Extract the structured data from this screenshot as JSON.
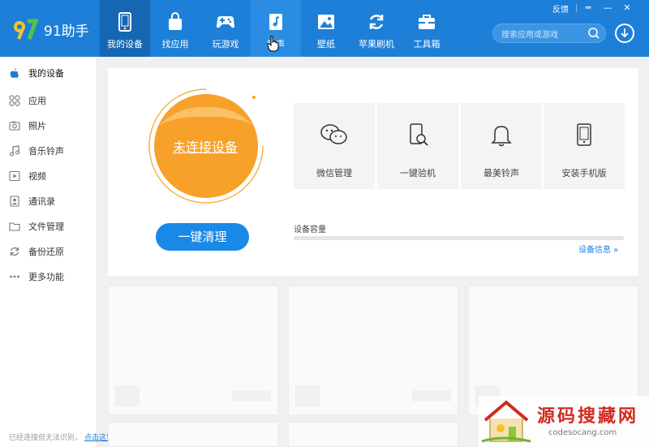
{
  "app": {
    "name": "91助手"
  },
  "window": {
    "feedback": "反馈",
    "menu": "═",
    "minimize": "—",
    "close": "✕"
  },
  "nav": [
    {
      "label": "我的设备",
      "icon": "phone-icon"
    },
    {
      "label": "找应用",
      "icon": "bag-icon"
    },
    {
      "label": "玩游戏",
      "icon": "gamepad-icon"
    },
    {
      "label": "铃声",
      "icon": "music-note-icon"
    },
    {
      "label": "壁纸",
      "icon": "image-icon"
    },
    {
      "label": "苹果刷机",
      "icon": "refresh-icon"
    },
    {
      "label": "工具箱",
      "icon": "toolbox-icon"
    }
  ],
  "search": {
    "placeholder": "搜索应用或游戏"
  },
  "sidebar": [
    {
      "label": "我的设备",
      "icon": "apple-icon"
    },
    {
      "label": "应用",
      "icon": "apps-grid-icon"
    },
    {
      "label": "照片",
      "icon": "camera-icon"
    },
    {
      "label": "音乐铃声",
      "icon": "music-icon"
    },
    {
      "label": "视频",
      "icon": "video-icon"
    },
    {
      "label": "通讯录",
      "icon": "contacts-icon"
    },
    {
      "label": "文件管理",
      "icon": "folder-icon"
    },
    {
      "label": "备份还原",
      "icon": "backup-icon"
    },
    {
      "label": "更多功能",
      "icon": "more-icon"
    }
  ],
  "device": {
    "status": "未连接设备",
    "clean_button": "一键清理"
  },
  "tiles": [
    {
      "label": "微信管理",
      "icon": "wechat-icon"
    },
    {
      "label": "一键验机",
      "icon": "phone-check-icon"
    },
    {
      "label": "最美铃声",
      "icon": "bell-icon"
    },
    {
      "label": "安装手机版",
      "icon": "mobile-icon"
    }
  ],
  "capacity": {
    "label": "设备容量",
    "info_link": "设备信息 »"
  },
  "statusbar": {
    "text": "已经连接但无法识别，",
    "link": "点击这里"
  },
  "watermark": {
    "title": "源码搜藏网",
    "url": "codesocang.com"
  },
  "colors": {
    "primary": "#1d7fd8",
    "nav_active": "#1566b3",
    "orange": "#f7a12a",
    "button": "#1a88e6"
  }
}
